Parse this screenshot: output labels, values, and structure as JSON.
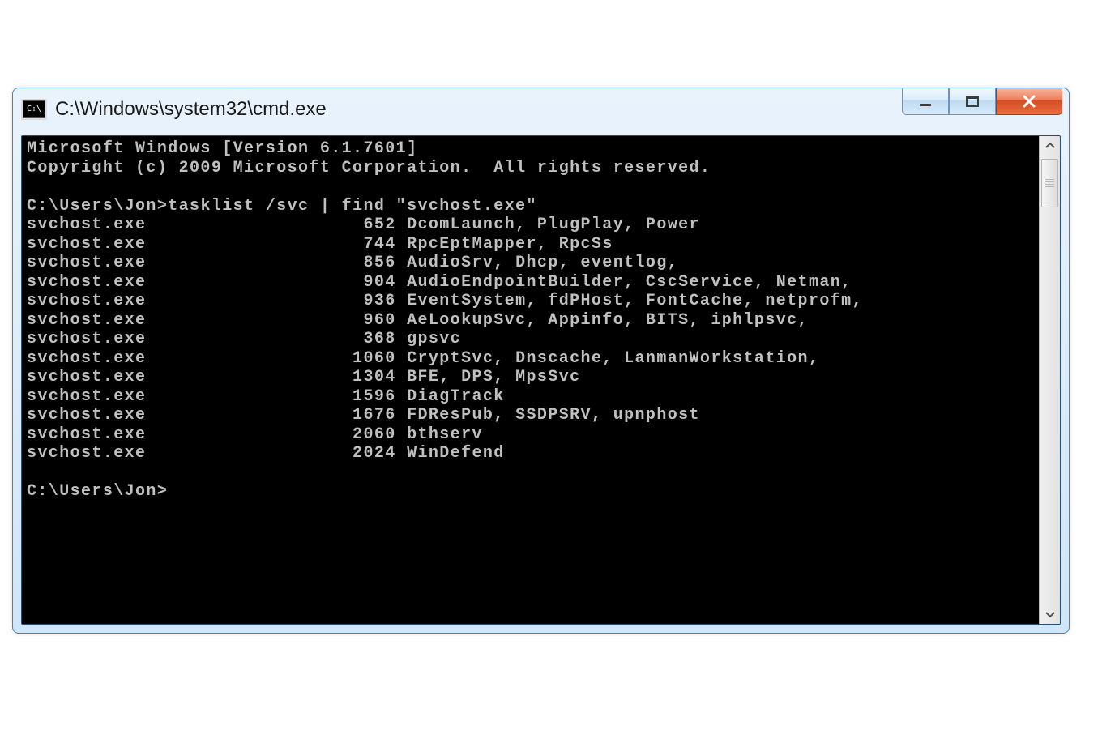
{
  "window": {
    "title": "C:\\Windows\\system32\\cmd.exe",
    "app_icon_text": "C:\\"
  },
  "console": {
    "banner1": "Microsoft Windows [Version 6.1.7601]",
    "banner2": "Copyright (c) 2009 Microsoft Corporation.  All rights reserved.",
    "prompt1_path": "C:\\Users\\Jon>",
    "command": "tasklist /svc | find \"svchost.exe\"",
    "prompt2_path": "C:\\Users\\Jon>",
    "rows": [
      {
        "name": "svchost.exe",
        "pid": "652",
        "services": "DcomLaunch, PlugPlay, Power"
      },
      {
        "name": "svchost.exe",
        "pid": "744",
        "services": "RpcEptMapper, RpcSs"
      },
      {
        "name": "svchost.exe",
        "pid": "856",
        "services": "AudioSrv, Dhcp, eventlog,"
      },
      {
        "name": "svchost.exe",
        "pid": "904",
        "services": "AudioEndpointBuilder, CscService, Netman,"
      },
      {
        "name": "svchost.exe",
        "pid": "936",
        "services": "EventSystem, fdPHost, FontCache, netprofm,"
      },
      {
        "name": "svchost.exe",
        "pid": "960",
        "services": "AeLookupSvc, Appinfo, BITS, iphlpsvc,"
      },
      {
        "name": "svchost.exe",
        "pid": "368",
        "services": "gpsvc"
      },
      {
        "name": "svchost.exe",
        "pid": "1060",
        "services": "CryptSvc, Dnscache, LanmanWorkstation,"
      },
      {
        "name": "svchost.exe",
        "pid": "1304",
        "services": "BFE, DPS, MpsSvc"
      },
      {
        "name": "svchost.exe",
        "pid": "1596",
        "services": "DiagTrack"
      },
      {
        "name": "svchost.exe",
        "pid": "1676",
        "services": "FDResPub, SSDPSRV, upnphost"
      },
      {
        "name": "svchost.exe",
        "pid": "2060",
        "services": "bthserv"
      },
      {
        "name": "svchost.exe",
        "pid": "2024",
        "services": "WinDefend"
      }
    ]
  }
}
